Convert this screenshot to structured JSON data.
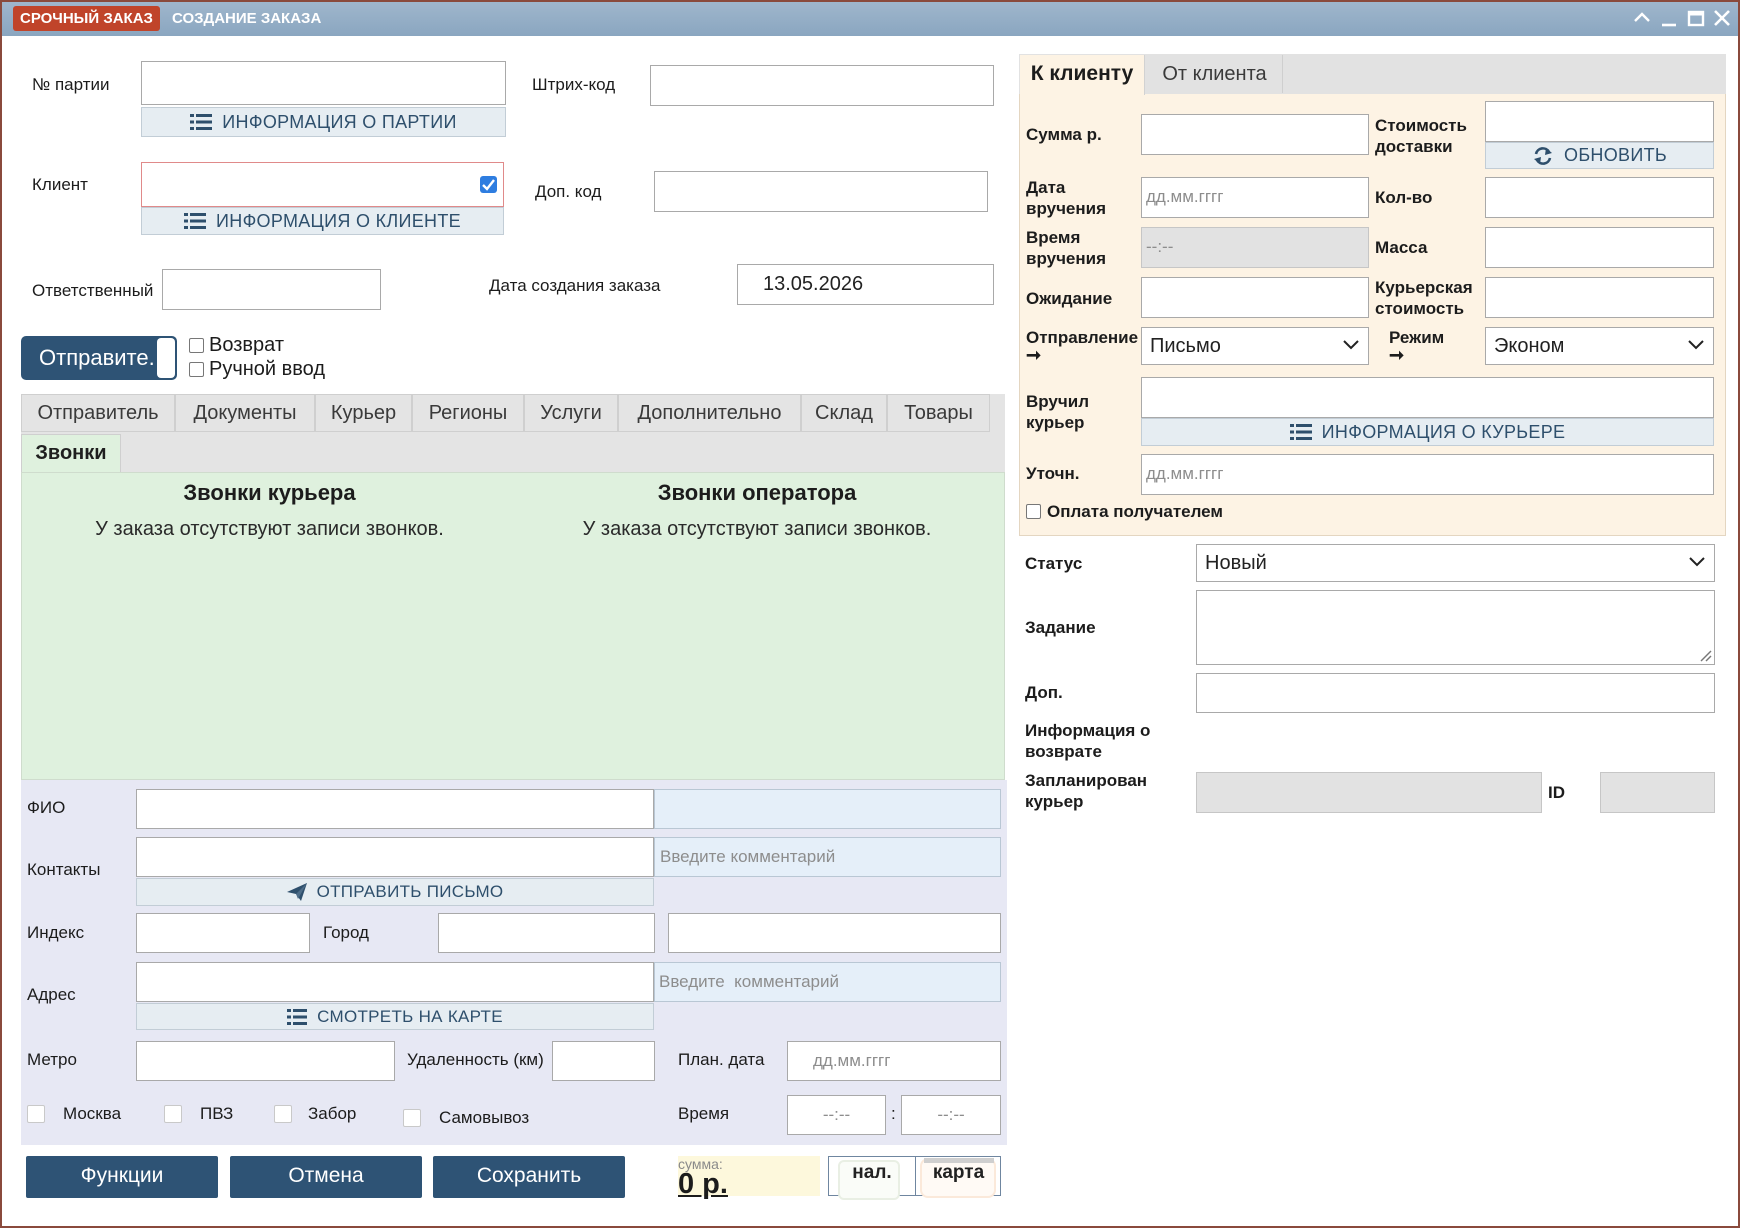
{
  "title_bar": {
    "badge": "СРОЧНЫЙ ЗАКАЗ",
    "title": "СОЗДАНИЕ ЗАКАЗА"
  },
  "left_top": {
    "batch_label": "№ партии",
    "batch_info": "ИНФОРМАЦИЯ О ПАРТИИ",
    "barcode_label": "Штрих-код",
    "client_label": "Клиент",
    "client_info": "ИНФОРМАЦИЯ О КЛИЕНТЕ",
    "extra_code_label": "Доп. код",
    "responsible_label": "Ответственный",
    "created_label": "Дата создания заказа",
    "created_value": "13.05.2026",
    "sender_button": "Отправите.",
    "return_label": "Возврат",
    "manual_label": "Ручной ввод"
  },
  "tabs": [
    "Отправитель",
    "Документы",
    "Курьер",
    "Регионы",
    "Услуги",
    "Дополнительно",
    "Склад",
    "Товары",
    "Звонки"
  ],
  "calls": {
    "courier_title": "Звонки курьера",
    "courier_empty": "У заказа отсутствуют записи звонков.",
    "operator_title": "Звонки оператора",
    "operator_empty": "У заказа отсутствуют записи звонков."
  },
  "address": {
    "fio_label": "ФИО",
    "contacts_label": "Контакты",
    "comment_placeholder": "Введите комментарий",
    "send_letter": "ОТПРАВИТЬ ПИСЬМО",
    "index_label": "Индекс",
    "city_label": "Город",
    "address_label": "Адрес",
    "address_comment_placeholder": "Введите  комментарий",
    "map_button": "СМОТРЕТЬ НА КАРТЕ",
    "metro_label": "Метро",
    "distance_label": "Удаленность (км)",
    "plan_date_label": "План. дата",
    "plan_date_placeholder": "дд.мм.гггг",
    "moscow_label": "Москва",
    "pvz_label": "ПВЗ",
    "pickup_label": "Забор",
    "self_label": "Самовывоз",
    "time_label": "Время",
    "time_from": "--:--",
    "time_sep": ":",
    "time_to": "--:--"
  },
  "footer": {
    "functions": "Функции",
    "cancel": "Отмена",
    "save": "Сохранить",
    "sum_caption": "сумма:",
    "sum_value": "0 р.",
    "cash": "нал.",
    "card": "карта"
  },
  "right_tabs": [
    "К клиенту",
    "От клиента"
  ],
  "right": {
    "sum_label": "Сумма р.",
    "delivery_cost_label": "Стоимость доставки",
    "refresh": "ОБНОВИТЬ",
    "delivery_date_label": "Дата вручения",
    "date_placeholder": "дд.мм.гггг",
    "qty_label": "Кол-во",
    "delivery_time_label": "Время вручения",
    "time_placeholder": "--:--",
    "weight_label": "Масса",
    "wait_label": "Ожидание",
    "courier_cost_label": "Курьерская стоимость",
    "shipment_label": "Отправление",
    "shipment_value": "Письмо",
    "mode_label": "Режим",
    "mode_value": "Эконом",
    "arrow": "➞",
    "handed_label": "Вручил курьер",
    "courier_info": "ИНФОРМАЦИЯ О КУРЬЕРЕ",
    "clarify_label": "Уточн.",
    "payer_label": "Оплата получателем"
  },
  "status": {
    "status_label": "Статус",
    "status_value": "Новый",
    "task_label": "Задание",
    "extra_label": "Доп.",
    "return_info_label": "Информация о возврате",
    "planned_courier_label": "Запланирован курьер",
    "id_label": "ID"
  }
}
